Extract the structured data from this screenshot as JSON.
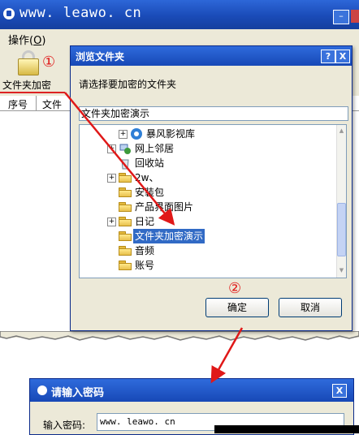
{
  "main_window": {
    "title": "www. leawo. cn",
    "minimize_glyph": "–",
    "menu": {
      "label": "操作(",
      "mnemonic": "O",
      "suffix": ")"
    },
    "toolbar": {
      "encrypt_folder_label": "文件夹加密"
    },
    "list_columns": [
      "序号",
      "文件"
    ]
  },
  "annotations": {
    "step1": "①",
    "step2": "②"
  },
  "browse_dialog": {
    "title": "浏览文件夹",
    "help_glyph": "?",
    "close_glyph": "X",
    "prompt": "请选择要加密的文件夹",
    "path_value": "文件夹加密演示",
    "tree": [
      {
        "label": "暴风影视库",
        "expander": "+",
        "icon": "media-library-icon"
      },
      {
        "label": "网上邻居",
        "expander": "+",
        "icon": "network-icon"
      },
      {
        "label": "回收站",
        "expander": "",
        "icon": "recycle-bin-icon"
      },
      {
        "label": "2w、",
        "expander": "+",
        "icon": "folder-icon"
      },
      {
        "label": "安装包",
        "expander": "",
        "icon": "folder-icon"
      },
      {
        "label": "产品界面图片",
        "expander": "",
        "icon": "folder-icon"
      },
      {
        "label": "日记",
        "expander": "+",
        "icon": "folder-icon"
      },
      {
        "label": "文件夹加密演示",
        "expander": "",
        "icon": "folder-icon",
        "selected": true
      },
      {
        "label": "音频",
        "expander": "",
        "icon": "folder-icon"
      },
      {
        "label": "账号",
        "expander": "",
        "icon": "folder-icon"
      }
    ],
    "ok_label": "确定",
    "cancel_label": "取消"
  },
  "password_dialog": {
    "title": "请输入密码",
    "close_glyph": "X",
    "label": "输入密码:",
    "value": "www. leawo. cn"
  },
  "colors": {
    "annotation_red": "#e01818",
    "title_blue": "#1a4bb8",
    "selection": "#316ac5"
  }
}
